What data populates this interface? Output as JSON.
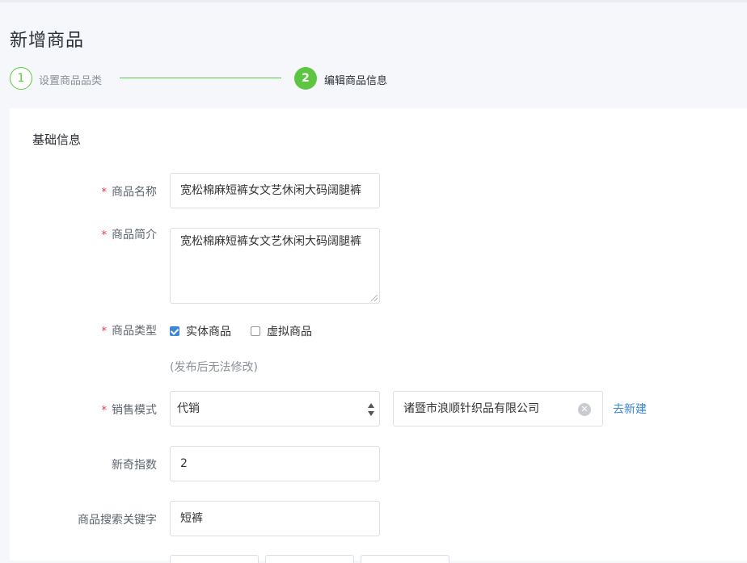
{
  "page": {
    "title": "新增商品"
  },
  "steps": [
    {
      "number": "1",
      "label": "设置商品品类"
    },
    {
      "number": "2",
      "label": "编辑商品信息"
    }
  ],
  "section": {
    "title": "基础信息"
  },
  "form": {
    "name": {
      "label": "商品名称",
      "value": "宽松棉麻短裤女文艺休闲大码阔腿裤"
    },
    "intro": {
      "label": "商品简介",
      "value": "宽松棉麻短裤女文艺休闲大码阔腿裤"
    },
    "type": {
      "label": "商品类型",
      "options": [
        {
          "label": "实体商品",
          "checked": true
        },
        {
          "label": "虚拟商品",
          "checked": false
        }
      ],
      "hint": "(发布后无法修改)"
    },
    "sales_mode": {
      "label": "销售模式",
      "selected": "代销",
      "supplier": "诸暨市浪顺针织品有限公司",
      "create_link": "去新建"
    },
    "novelty": {
      "label": "新奇指数",
      "value": "2"
    },
    "keywords": {
      "label": "商品搜索关键字",
      "value": "短裤"
    }
  },
  "required_mark": "*",
  "colors": {
    "accent_green": "#5ec542",
    "link_blue": "#3b86d6",
    "required_red": "#e0383e"
  }
}
